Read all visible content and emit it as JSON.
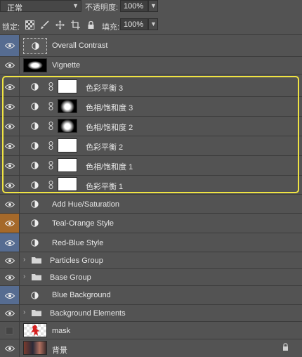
{
  "toolbar": {
    "blend_mode": "正常",
    "opacity_label": "不透明度:",
    "opacity_value": "100%",
    "lock_label": "锁定:",
    "fill_label": "填充:",
    "fill_value": "100%"
  },
  "layers": [
    {
      "name": "Overall Contrast",
      "kind": "adjustment-dashed"
    },
    {
      "name": "Vignette",
      "kind": "vignette"
    },
    {
      "name": "色彩平衡 3",
      "kind": "adjustment-mask-white"
    },
    {
      "name": "色相/饱和度 3",
      "kind": "adjustment-mask-blob"
    },
    {
      "name": "色相/饱和度 2",
      "kind": "adjustment-mask-blob"
    },
    {
      "name": "色彩平衡 2",
      "kind": "adjustment-mask-white"
    },
    {
      "name": "色相/饱和度 1",
      "kind": "adjustment-mask-white"
    },
    {
      "name": "色彩平衡 1",
      "kind": "adjustment-mask-white"
    },
    {
      "name": "Add Hue/Saturation",
      "kind": "adjustment"
    },
    {
      "name": "Teal-Orange Style",
      "kind": "adjustment"
    },
    {
      "name": "Red-Blue Style",
      "kind": "adjustment"
    },
    {
      "name": "Particles Group",
      "kind": "group"
    },
    {
      "name": "Base Group",
      "kind": "group"
    },
    {
      "name": "Blue Background",
      "kind": "adjustment"
    },
    {
      "name": "Background Elements",
      "kind": "group"
    },
    {
      "name": "mask",
      "kind": "image"
    },
    {
      "name": "背景",
      "kind": "image-locked"
    }
  ],
  "colors": {
    "panel_bg": "#535353",
    "visibility_blue": "#566c91",
    "visibility_orange": "#a5692a",
    "highlight_yellow": "#f0e442"
  }
}
